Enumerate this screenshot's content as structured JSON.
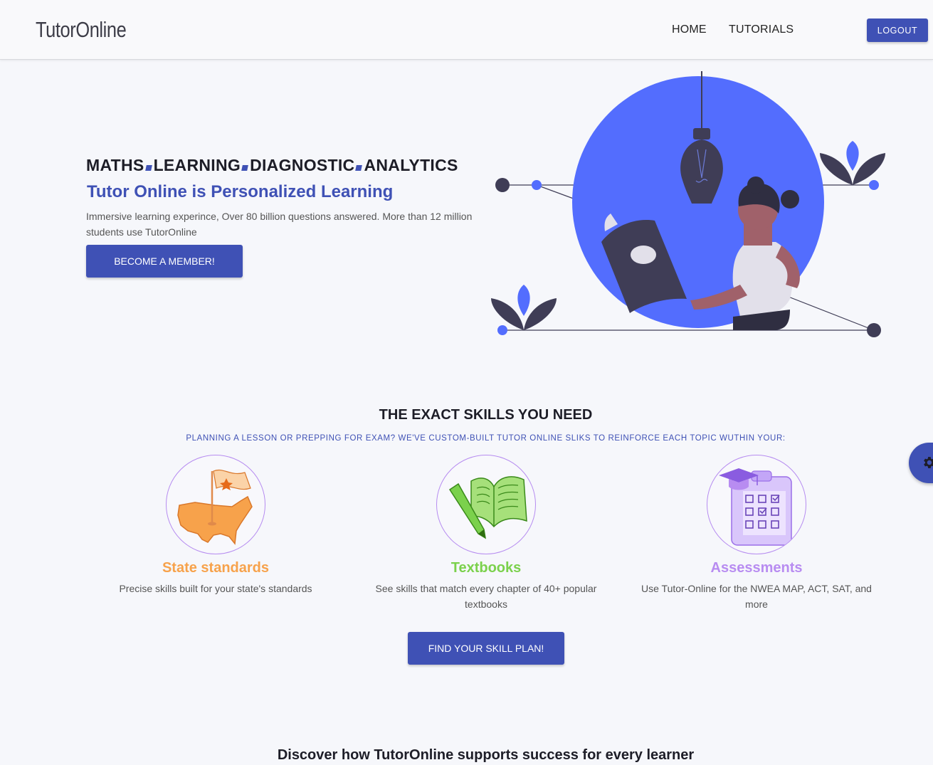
{
  "header": {
    "logo": "TutorOnline",
    "nav": {
      "home": "HOME",
      "tutorials": "TUTORIALS"
    },
    "logout_label": "LOGOUT"
  },
  "hero": {
    "tagline": [
      "MATHS",
      "LEARNING",
      "DIAGNOSTIC",
      "ANALYTICS"
    ],
    "title": "Tutor Online is Personalized Learning",
    "description": "Immersive learning experince, Over 80 billion questions answered. More than 12 million students use TutorOnline",
    "cta_label": "BECOME A MEMBER!"
  },
  "skills": {
    "title": "THE EXACT SKILLS YOU NEED",
    "subtitle": "PLANNING A LESSON OR PREPPING FOR EXAM? WE'VE CUSTOM-BUILT TUTOR ONLINE SLIKS TO REINFORCE EACH TOPIC WUTHIN YOUR:",
    "cards": [
      {
        "title": "State standards",
        "description": "Precise skills built for your state's standards",
        "icon": "us-map-flag-icon",
        "color": "#f7a24b"
      },
      {
        "title": "Textbooks",
        "description": "See skills that match every chapter of 40+ popular textbooks",
        "icon": "open-book-pencil-icon",
        "color": "#7bd14c"
      },
      {
        "title": "Assessments",
        "description": "Use Tutor-Online for the NWEA MAP, ACT, SAT, and more",
        "icon": "clipboard-checklist-icon",
        "color": "#b88cf1"
      }
    ],
    "cta_label": "FIND YOUR SKILL PLAN!"
  },
  "side_tab": {
    "icon": "gear-icon"
  },
  "discover": {
    "title": "Discover how TutorOnline supports success for every learner"
  },
  "colors": {
    "primary": "#3f51b5",
    "illustration_blue": "#536dfe",
    "dark": "#3f3d56",
    "background": "#f6f7fb"
  }
}
